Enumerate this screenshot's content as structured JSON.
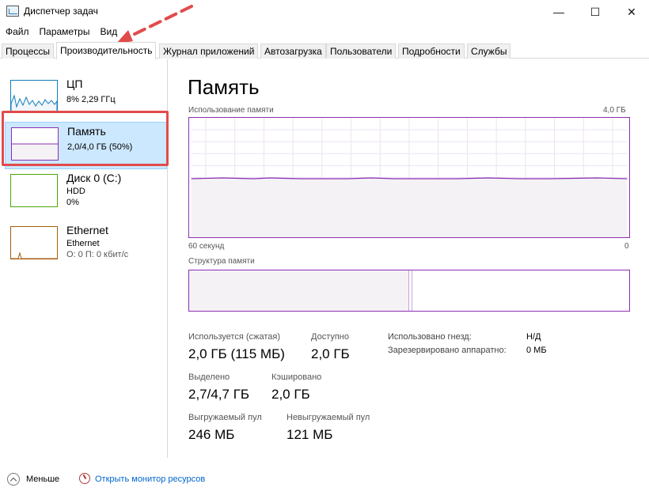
{
  "window": {
    "title": "Диспетчер задач",
    "minimize_glyph": "—",
    "maximize_glyph": "☐",
    "close_glyph": "✕"
  },
  "menu": [
    "Файл",
    "Параметры",
    "Вид"
  ],
  "tabs": [
    {
      "label": "Процессы"
    },
    {
      "label": "Производительность",
      "active": true
    },
    {
      "label": "Журнал приложений"
    },
    {
      "label": "Автозагрузка"
    },
    {
      "label": "Пользователи"
    },
    {
      "label": "Подробности"
    },
    {
      "label": "Службы"
    }
  ],
  "sidebar": {
    "items": [
      {
        "title": "ЦП",
        "sub1": "8% 2,29 ГГц",
        "sub2": "",
        "color": "#117dbb"
      },
      {
        "title": "Память",
        "sub1": "2,0/4,0 ГБ (50%)",
        "sub2": "",
        "color": "#8b2fb5",
        "selected": true
      },
      {
        "title": "Диск 0 (C:)",
        "sub1": "HDD",
        "sub2": "0%",
        "color": "#4da60c"
      },
      {
        "title": "Ethernet",
        "sub1": "Ethernet",
        "sub2": "О: 0 П: 0 кбит/с",
        "color": "#a75e0c"
      }
    ]
  },
  "main": {
    "title": "Память",
    "usage_label": "Использование памяти",
    "usage_max": "4,0 ГБ",
    "time_label": "60 секунд",
    "time_min": "0",
    "structure_label": "Структура памяти",
    "used_fraction": 0.5,
    "stats": {
      "in_use_label": "Используется (сжатая)",
      "in_use_value": "2,0 ГБ (115 МБ)",
      "available_label": "Доступно",
      "available_value": "2,0 ГБ",
      "committed_label": "Выделено",
      "committed_value": "2,7/4,7 ГБ",
      "cached_label": "Кэшировано",
      "cached_value": "2,0 ГБ",
      "paged_label": "Выгружаемый пул",
      "paged_value": "246 МБ",
      "nonpaged_label": "Невыгружаемый пул",
      "nonpaged_value": "121 МБ",
      "slots_label": "Использовано гнезд:",
      "slots_value": "Н/Д",
      "reserved_label": "Зарезервировано аппаратно:",
      "reserved_value": "0 МБ"
    }
  },
  "footer": {
    "fewer_label": "Меньше",
    "resmon_label": "Открыть монитор ресурсов"
  },
  "annotation_color": "#e24b4b"
}
